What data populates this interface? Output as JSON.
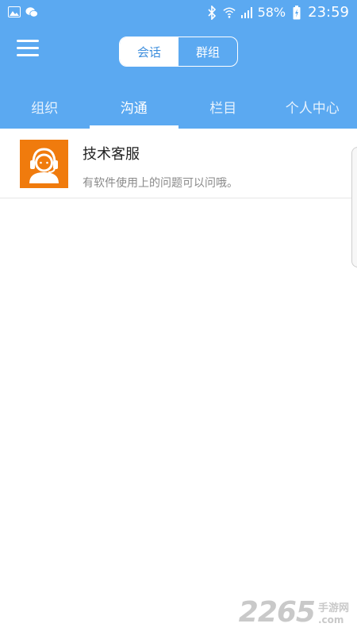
{
  "status_bar": {
    "battery": "58%",
    "time": "23:59",
    "icons": [
      "gallery-icon",
      "wechat-icon",
      "bluetooth-icon",
      "wifi-icon",
      "signal-icon",
      "battery-charging-icon"
    ]
  },
  "segmented": {
    "active": "会话",
    "inactive": "群组"
  },
  "tabs": [
    {
      "label": "组织",
      "active": false
    },
    {
      "label": "沟通",
      "active": true
    },
    {
      "label": "栏目",
      "active": false
    },
    {
      "label": "个人中心",
      "active": false
    }
  ],
  "conversations": [
    {
      "title": "技术客服",
      "subtitle": "有软件使用上的问题可以问哦。",
      "avatar_icon": "customer-service-headset-icon"
    }
  ],
  "watermark": {
    "number": "2265",
    "cn": "手游网",
    "domain": ".com"
  },
  "colors": {
    "header": "#5ba9f1",
    "avatar": "#f07b0d",
    "segment_active_text": "#3f8fdd"
  }
}
